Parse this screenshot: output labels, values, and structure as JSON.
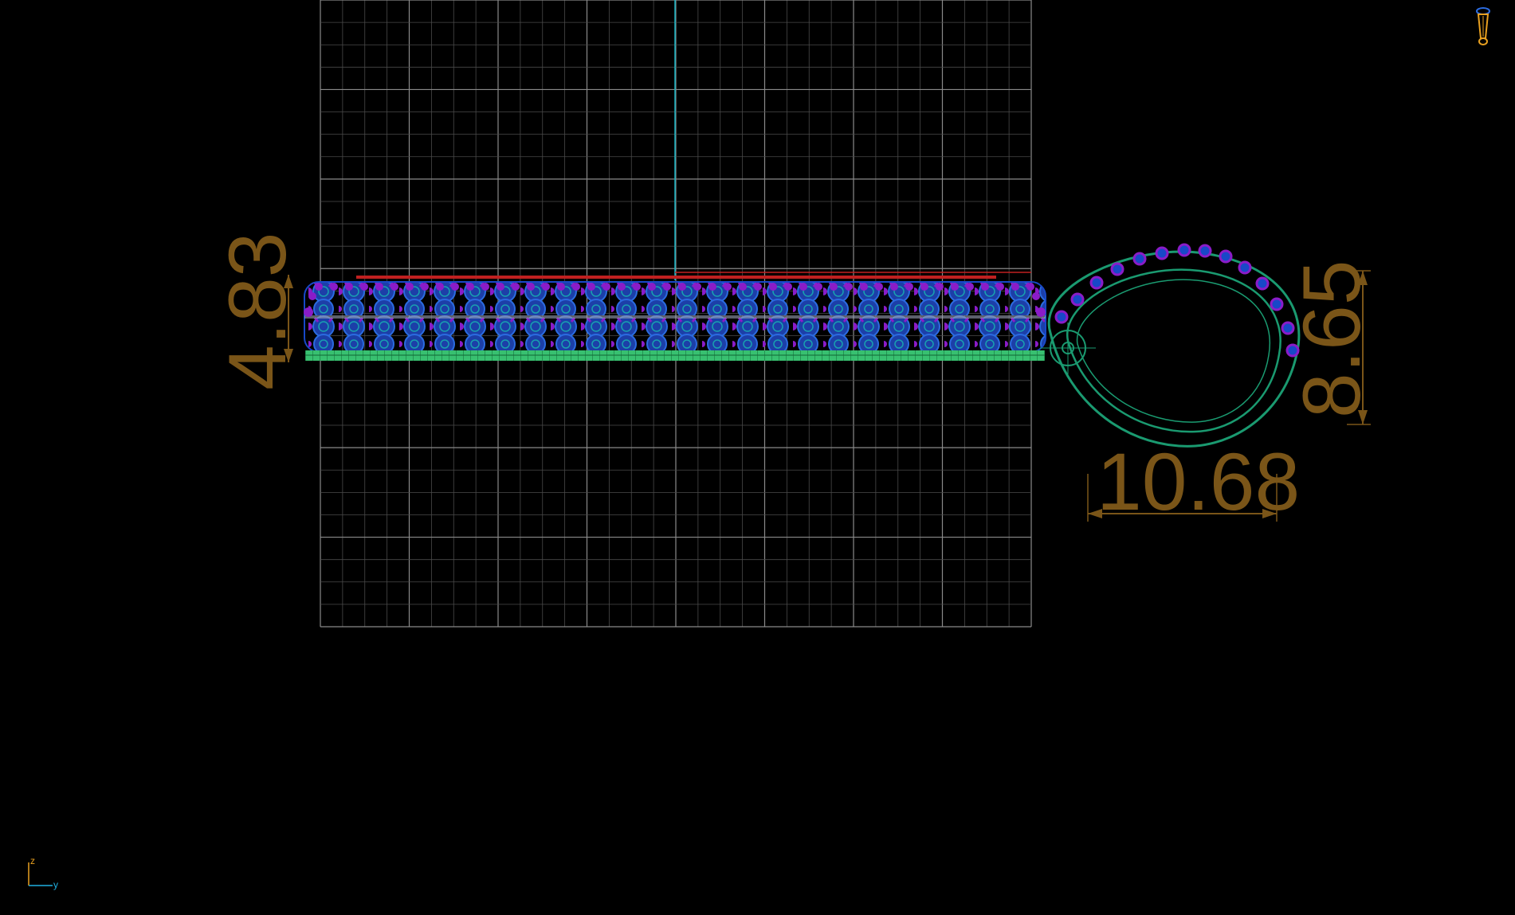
{
  "viewport": {
    "view": "front",
    "background": "#000000"
  },
  "colors": {
    "grid_major": "#8a8a8a",
    "grid_minor": "#4a4a4a",
    "center_axis": "#16b6c4",
    "dimension": "#7a5518",
    "stones_blue": "#1848c8",
    "stones_purple": "#8a1cc8",
    "stones_teal": "#18a0b0",
    "base_green": "#38c070",
    "profile_green": "#1a9a70",
    "red_outline": "#c02020",
    "axis_z": "#e8a020",
    "axis_y": "#20b0e0"
  },
  "dimensions": {
    "height": "4.83",
    "width": "10.68",
    "depth": "8.65"
  },
  "axis_indicator": {
    "z_label": "z",
    "y_label": "y"
  },
  "view_cube": {
    "icon": "ring-view-cube-icon"
  }
}
